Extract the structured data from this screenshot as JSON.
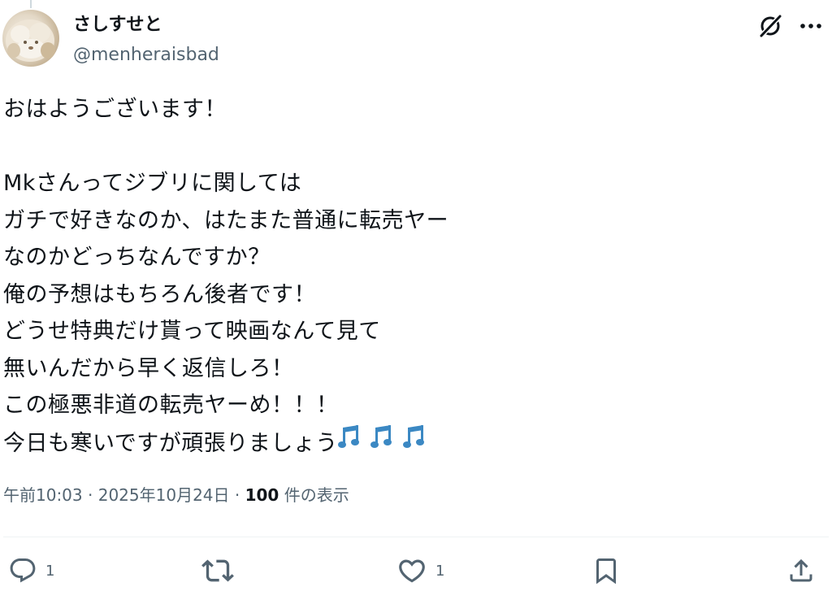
{
  "author": {
    "display_name": "さしすせと",
    "handle": "@menheraisbad",
    "avatar_icon": "dog-avatar"
  },
  "header_icons": {
    "grok": "grok-icon",
    "more": "more-icon"
  },
  "tweet": {
    "lines": [
      "おはようございます！",
      "",
      "Mkさんってジブリに関しては",
      "ガチで好きなのか、はたまた普通に転売ヤー",
      "なのかどっちなんですか？",
      "俺の予想はもちろん後者です！",
      "どうせ特典だけ貰って映画なんて見て",
      "無いんだから早く返信しろ！",
      "この極悪非道の転売ヤーめ！！！",
      "今日も寒いですが頑張りましょう"
    ],
    "trailing_emoji": "musical-notes-emoji"
  },
  "meta": {
    "time": "午前10:03",
    "separator": "·",
    "date": "2025年10月24日",
    "views_count": "100",
    "views_label": " 件の表示"
  },
  "actions": {
    "reply_count": "1",
    "like_count": "1"
  },
  "colors": {
    "text": "#0f1419",
    "secondary": "#536471",
    "emoji_blue": "#3b88c3"
  }
}
